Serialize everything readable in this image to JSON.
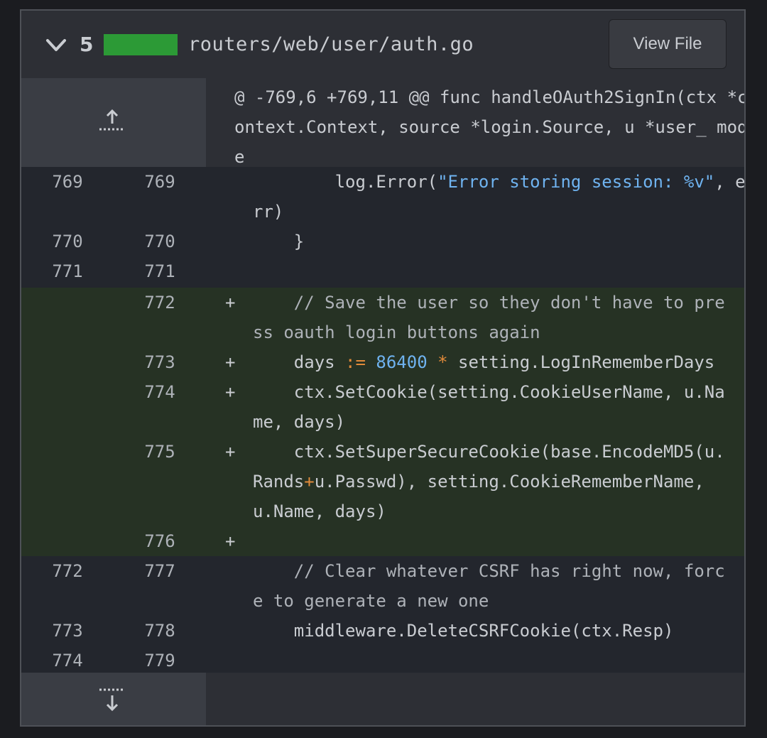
{
  "header": {
    "stat_count": "5",
    "file_path": "routers/web/user/auth.go",
    "view_file_label": "View File",
    "stat_color": "#2c9a36"
  },
  "hunk": {
    "text": "@ -769,6 +769,11 @@ func handleOAuth2SignIn(ctx *context.Context, source *login.Source, u *user_ mode"
  },
  "lines": [
    {
      "old": "769",
      "new": "769",
      "sign": "",
      "type": "ctx"
    },
    {
      "old": "770",
      "new": "770",
      "sign": "",
      "type": "ctx"
    },
    {
      "old": "771",
      "new": "771",
      "sign": "",
      "type": "ctx"
    },
    {
      "old": "",
      "new": "772",
      "sign": "+",
      "type": "add"
    },
    {
      "old": "",
      "new": "773",
      "sign": "+",
      "type": "add"
    },
    {
      "old": "",
      "new": "774",
      "sign": "+",
      "type": "add"
    },
    {
      "old": "",
      "new": "775",
      "sign": "+",
      "type": "add"
    },
    {
      "old": "",
      "new": "776",
      "sign": "+",
      "type": "add"
    },
    {
      "old": "772",
      "new": "777",
      "sign": "",
      "type": "ctx"
    },
    {
      "old": "773",
      "new": "778",
      "sign": "",
      "type": "ctx"
    },
    {
      "old": "774",
      "new": "779",
      "sign": "",
      "type": "ctx"
    }
  ],
  "code": {
    "l769_a": "        log.Error(",
    "l769_str": "\"Error storing session: %v\"",
    "l769_b": ", e",
    "l769_c": "rr)",
    "l770": "    }",
    "l771": "",
    "l772_a": "    // Save the user so they don't have to pre",
    "l772_b": "ss oauth login buttons again",
    "l773_a": "    days ",
    "l773_op": ":=",
    "l773_sp": " ",
    "l773_num": "86400",
    "l773_sp2": " ",
    "l773_op2": "*",
    "l773_b": " setting.LogInRememberDays",
    "l774_a": "    ctx.SetCookie(setting.CookieUserName, u.Na",
    "l774_b": "me, days)",
    "l775_a": "    ctx.SetSuperSecureCookie(base.EncodeMD5(u.",
    "l775_b1": "Rands",
    "l775_op": "+",
    "l775_b2": "u.Passwd), setting.CookieRememberName,",
    "l775_c": "u.Name, days)",
    "l776": "",
    "l777_a": "    // Clear whatever CSRF has right now, forc",
    "l777_b": "e to generate a new one",
    "l778": "    middleware.DeleteCSRFCookie(ctx.Resp)",
    "l779": ""
  },
  "icons": {
    "collapse": "chevron-down",
    "expand_up": "expand-up",
    "expand_down": "expand-down"
  }
}
